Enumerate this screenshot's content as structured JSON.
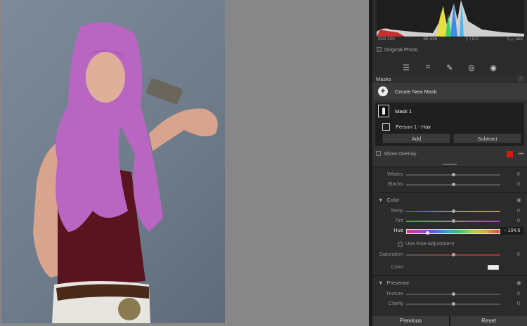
{
  "histogram": {
    "iso": "ISO 100",
    "focal": "85 mm",
    "aperture": "ƒ / 9.0",
    "shutter": "¹⁄₁₂₅ sec",
    "original_photo_label": "Original Photo"
  },
  "toolbar": {
    "icons": [
      "edit-sliders-icon",
      "crop-icon",
      "healing-icon",
      "red-eye-icon",
      "masking-icon"
    ]
  },
  "masks": {
    "title": "Masks",
    "create_label": "Create New Mask",
    "mask1_label": "Mask 1",
    "component_label": "Person 1 - Hair",
    "add_label": "Add",
    "subtract_label": "Subtract",
    "show_overlay_label": "Show Overlay",
    "overlay_color": "#d61a0c"
  },
  "tone": {
    "whites_label": "Whites",
    "whites_value": "0",
    "blacks_label": "Blacks",
    "blacks_value": "0"
  },
  "color": {
    "title": "Color",
    "temp_label": "Temp",
    "temp_value": "0",
    "tint_label": "Tint",
    "tint_value": "0",
    "hue_label": "Hue",
    "hue_value": "− 104.6",
    "fine_label": "Use Fine Adjustment",
    "saturation_label": "Saturation",
    "saturation_value": "0",
    "color_label": "Color"
  },
  "presence": {
    "title": "Presence",
    "texture_label": "Texture",
    "texture_value": "0",
    "clarity_label": "Clarity",
    "clarity_value": "0"
  },
  "footer": {
    "previous_label": "Previous",
    "reset_label": "Reset"
  }
}
